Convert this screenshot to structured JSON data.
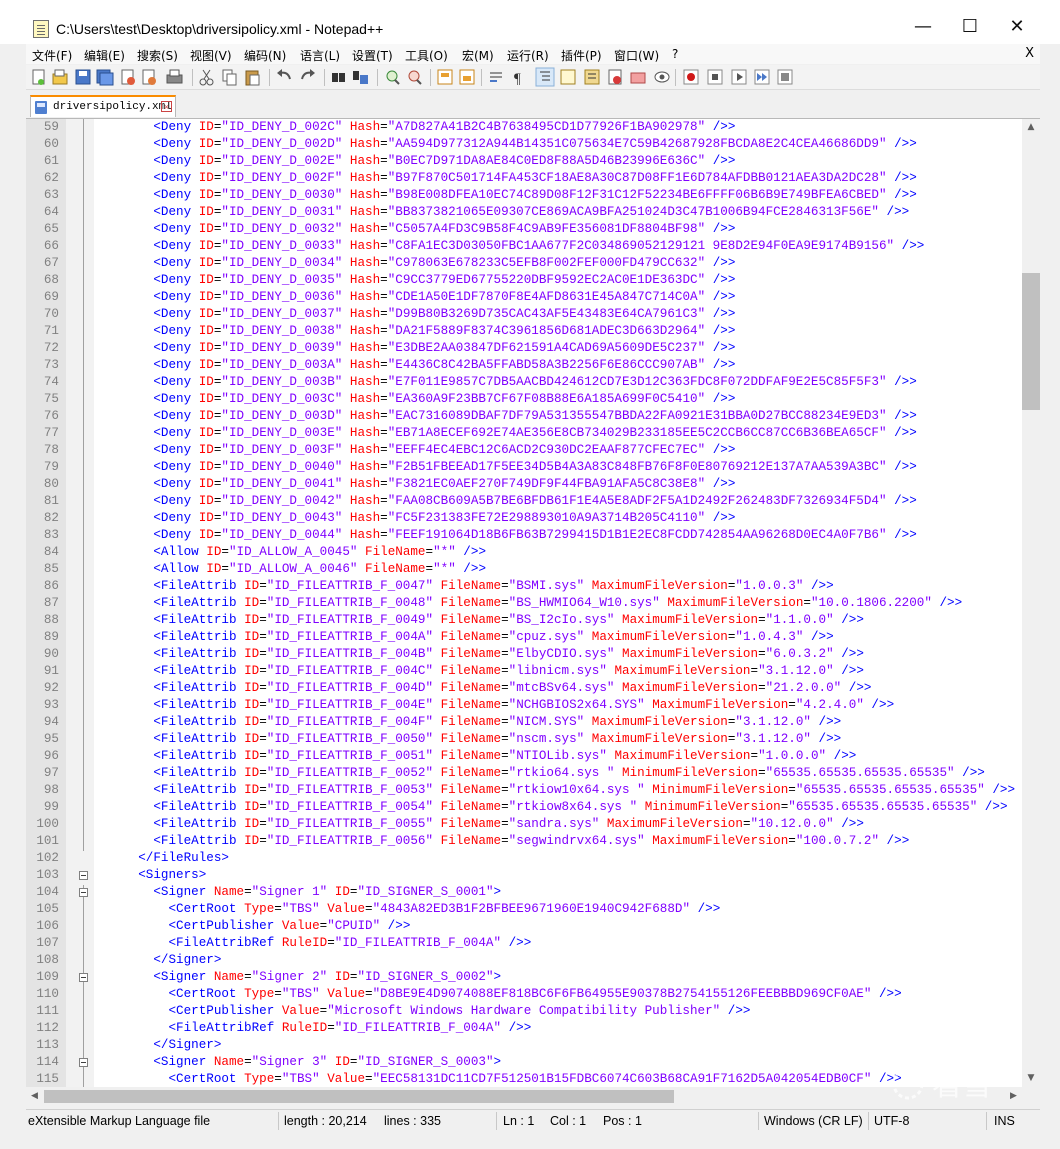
{
  "window": {
    "title": "C:\\Users\\test\\Desktop\\driversipolicy.xml - Notepad++",
    "minimize": "—",
    "maximize": "☐",
    "close": "✕"
  },
  "menu": {
    "items": [
      "文件(F)",
      "编辑(E)",
      "搜索(S)",
      "视图(V)",
      "编码(N)",
      "语言(L)",
      "设置(T)",
      "工具(O)",
      "宏(M)",
      "运行(R)",
      "插件(P)",
      "窗口(W)",
      "?"
    ],
    "close": "X"
  },
  "toolbar": {
    "buttons": [
      "new-file-icon",
      "open-file-icon",
      "save-icon",
      "save-all-icon",
      "close-icon",
      "close-all-icon",
      "print-icon",
      "cut-icon",
      "copy-icon",
      "paste-icon",
      "undo-icon",
      "redo-icon",
      "find-icon",
      "replace-icon",
      "zoom-in-icon",
      "zoom-out-icon",
      "sync-vertical-icon",
      "sync-horizontal-icon",
      "word-wrap-icon",
      "show-all-chars-icon",
      "indent-guide-icon",
      "doc-map-icon",
      "function-list-icon",
      "folder-workspace-icon",
      "doc-switcher-icon",
      "monitoring-icon",
      "record-macro-icon",
      "stop-record-icon",
      "play-macro-icon",
      "run-macro-multiple-icon",
      "save-macro-icon"
    ]
  },
  "tab": {
    "label": "driversipolicy.xml"
  },
  "editor": {
    "lines": [
      {
        "n": "59",
        "indent": "      ",
        "tag": "Deny",
        "attrs": [
          [
            "ID",
            "ID_DENY_D_002C"
          ],
          [
            "Hash",
            "A7D827A41B2C4B7638495CD1D77926F1BA902978"
          ]
        ],
        "end": " />"
      },
      {
        "n": "60",
        "indent": "      ",
        "tag": "Deny",
        "attrs": [
          [
            "ID",
            "ID_DENY_D_002D"
          ],
          [
            "Hash",
            "AA594D977312A944B14351C075634E7C59B42687928FBCDA8E2C4CEA46686DD9"
          ]
        ],
        "end": " />"
      },
      {
        "n": "61",
        "indent": "      ",
        "tag": "Deny",
        "attrs": [
          [
            "ID",
            "ID_DENY_D_002E"
          ],
          [
            "Hash",
            "B0EC7D971DA8AE84C0ED8F88A5D46B23996E636C"
          ]
        ],
        "end": " />"
      },
      {
        "n": "62",
        "indent": "      ",
        "tag": "Deny",
        "attrs": [
          [
            "ID",
            "ID_DENY_D_002F"
          ],
          [
            "Hash",
            "B97F870C501714FA453CF18AE8A30C87D08FF1E6D784AFDBB0121AEA3DA2DC28"
          ]
        ],
        "end": " />"
      },
      {
        "n": "63",
        "indent": "      ",
        "tag": "Deny",
        "attrs": [
          [
            "ID",
            "ID_DENY_D_0030"
          ],
          [
            "Hash",
            "B98E008DFEA10EC74C89D08F12F31C12F52234BE6FFFF06B6B9E749BFEA6CBED"
          ]
        ],
        "end": " />"
      },
      {
        "n": "64",
        "indent": "      ",
        "tag": "Deny",
        "attrs": [
          [
            "ID",
            "ID_DENY_D_0031"
          ],
          [
            "Hash",
            "BB8373821065E09307CE869ACA9BFA251024D3C47B1006B94FCE2846313F56E"
          ]
        ],
        "end": " />"
      },
      {
        "n": "65",
        "indent": "      ",
        "tag": "Deny",
        "attrs": [
          [
            "ID",
            "ID_DENY_D_0032"
          ],
          [
            "Hash",
            "C5057A4FD3C9B58F4C9AB9FE356081DF8804BF98"
          ]
        ],
        "end": " />"
      },
      {
        "n": "66",
        "indent": "      ",
        "tag": "Deny",
        "attrs": [
          [
            "ID",
            "ID_DENY_D_0033"
          ],
          [
            "Hash",
            "C8FA1EC3D03050FBC1AA677F2C034869052129121 9E8D2E94F0EA9E9174B9156"
          ]
        ],
        "end": " />"
      },
      {
        "n": "67",
        "indent": "      ",
        "tag": "Deny",
        "attrs": [
          [
            "ID",
            "ID_DENY_D_0034"
          ],
          [
            "Hash",
            "C978063E678233C5EFB8F002FEF000FD479CC632"
          ]
        ],
        "end": " />"
      },
      {
        "n": "68",
        "indent": "      ",
        "tag": "Deny",
        "attrs": [
          [
            "ID",
            "ID_DENY_D_0035"
          ],
          [
            "Hash",
            "C9CC3779ED67755220DBF9592EC2AC0E1DE363DC"
          ]
        ],
        "end": " />"
      },
      {
        "n": "69",
        "indent": "      ",
        "tag": "Deny",
        "attrs": [
          [
            "ID",
            "ID_DENY_D_0036"
          ],
          [
            "Hash",
            "CDE1A50E1DF7870F8E4AFD8631E45A847C714C0A"
          ]
        ],
        "end": " />"
      },
      {
        "n": "70",
        "indent": "      ",
        "tag": "Deny",
        "attrs": [
          [
            "ID",
            "ID_DENY_D_0037"
          ],
          [
            "Hash",
            "D99B80B3269D735CAC43AF5E43483E64CA7961C3"
          ]
        ],
        "end": " />"
      },
      {
        "n": "71",
        "indent": "      ",
        "tag": "Deny",
        "attrs": [
          [
            "ID",
            "ID_DENY_D_0038"
          ],
          [
            "Hash",
            "DA21F5889F8374C3961856D681ADEC3D663D2964"
          ]
        ],
        "end": " />"
      },
      {
        "n": "72",
        "indent": "      ",
        "tag": "Deny",
        "attrs": [
          [
            "ID",
            "ID_DENY_D_0039"
          ],
          [
            "Hash",
            "E3DBE2AA03847DF621591A4CAD69A5609DE5C237"
          ]
        ],
        "end": " />"
      },
      {
        "n": "73",
        "indent": "      ",
        "tag": "Deny",
        "attrs": [
          [
            "ID",
            "ID_DENY_D_003A"
          ],
          [
            "Hash",
            "E4436C8C42BA5FFABD58A3B2256F6E86CCC907AB"
          ]
        ],
        "end": " />"
      },
      {
        "n": "74",
        "indent": "      ",
        "tag": "Deny",
        "attrs": [
          [
            "ID",
            "ID_DENY_D_003B"
          ],
          [
            "Hash",
            "E7F011E9857C7DB5AACBD424612CD7E3D12C363FDC8F072DDFAF9E2E5C85F5F3"
          ]
        ],
        "end": " />"
      },
      {
        "n": "75",
        "indent": "      ",
        "tag": "Deny",
        "attrs": [
          [
            "ID",
            "ID_DENY_D_003C"
          ],
          [
            "Hash",
            "EA360A9F23BB7CF67F08B88E6A185A699F0C5410"
          ]
        ],
        "end": " />"
      },
      {
        "n": "76",
        "indent": "      ",
        "tag": "Deny",
        "attrs": [
          [
            "ID",
            "ID_DENY_D_003D"
          ],
          [
            "Hash",
            "EAC7316089DBAF7DF79A531355547BBDA22FA0921E31BBA0D27BCC88234E9ED3"
          ]
        ],
        "end": " />"
      },
      {
        "n": "77",
        "indent": "      ",
        "tag": "Deny",
        "attrs": [
          [
            "ID",
            "ID_DENY_D_003E"
          ],
          [
            "Hash",
            "EB71A8ECEF692E74AE356E8CB734029B233185EE5C2CCB6CC87CC6B36BEA65CF"
          ]
        ],
        "end": " />"
      },
      {
        "n": "78",
        "indent": "      ",
        "tag": "Deny",
        "attrs": [
          [
            "ID",
            "ID_DENY_D_003F"
          ],
          [
            "Hash",
            "EEFF4EC4EBC12C6ACD2C930DC2EAAF877CFEC7EC"
          ]
        ],
        "end": " />"
      },
      {
        "n": "79",
        "indent": "      ",
        "tag": "Deny",
        "attrs": [
          [
            "ID",
            "ID_DENY_D_0040"
          ],
          [
            "Hash",
            "F2B51FBEEAD17F5EE34D5B4A3A83C848FB76F8F0E80769212E137A7AA539A3BC"
          ]
        ],
        "end": " />"
      },
      {
        "n": "80",
        "indent": "      ",
        "tag": "Deny",
        "attrs": [
          [
            "ID",
            "ID_DENY_D_0041"
          ],
          [
            "Hash",
            "F3821EC0AEF270F749DF9F44FBA91AFA5C8C38E8"
          ]
        ],
        "end": " />"
      },
      {
        "n": "81",
        "indent": "      ",
        "tag": "Deny",
        "attrs": [
          [
            "ID",
            "ID_DENY_D_0042"
          ],
          [
            "Hash",
            "FAA08CB609A5B7BE6BFDB61F1E4A5E8ADF2F5A1D2492F262483DF7326934F5D4"
          ]
        ],
        "end": " />"
      },
      {
        "n": "82",
        "indent": "      ",
        "tag": "Deny",
        "attrs": [
          [
            "ID",
            "ID_DENY_D_0043"
          ],
          [
            "Hash",
            "FC5F231383FE72E298893010A9A3714B205C4110"
          ]
        ],
        "end": " />"
      },
      {
        "n": "83",
        "indent": "      ",
        "tag": "Deny",
        "attrs": [
          [
            "ID",
            "ID_DENY_D_0044"
          ],
          [
            "Hash",
            "FEEF191064D18B6FB63B7299415D1B1E2EC8FCDD742854AA96268D0EC4A0F7B6"
          ]
        ],
        "end": " />"
      },
      {
        "n": "84",
        "indent": "      ",
        "tag": "Allow",
        "attrs": [
          [
            "ID",
            "ID_ALLOW_A_0045"
          ],
          [
            "FileName",
            "*"
          ]
        ],
        "end": " />"
      },
      {
        "n": "85",
        "indent": "      ",
        "tag": "Allow",
        "attrs": [
          [
            "ID",
            "ID_ALLOW_A_0046"
          ],
          [
            "FileName",
            "*"
          ]
        ],
        "end": " />"
      },
      {
        "n": "86",
        "indent": "      ",
        "tag": "FileAttrib",
        "attrs": [
          [
            "ID",
            "ID_FILEATTRIB_F_0047"
          ],
          [
            "FileName",
            "BSMI.sys"
          ],
          [
            "MaximumFileVersion",
            "1.0.0.3"
          ]
        ],
        "end": " />"
      },
      {
        "n": "87",
        "indent": "      ",
        "tag": "FileAttrib",
        "attrs": [
          [
            "ID",
            "ID_FILEATTRIB_F_0048"
          ],
          [
            "FileName",
            "BS_HWMIO64_W10.sys"
          ],
          [
            "MaximumFileVersion",
            "10.0.1806.2200"
          ]
        ],
        "end": " />"
      },
      {
        "n": "88",
        "indent": "      ",
        "tag": "FileAttrib",
        "attrs": [
          [
            "ID",
            "ID_FILEATTRIB_F_0049"
          ],
          [
            "FileName",
            "BS_I2cIo.sys"
          ],
          [
            "MaximumFileVersion",
            "1.1.0.0"
          ]
        ],
        "end": " />"
      },
      {
        "n": "89",
        "indent": "      ",
        "tag": "FileAttrib",
        "attrs": [
          [
            "ID",
            "ID_FILEATTRIB_F_004A"
          ],
          [
            "FileName",
            "cpuz.sys"
          ],
          [
            "MaximumFileVersion",
            "1.0.4.3"
          ]
        ],
        "end": " />"
      },
      {
        "n": "90",
        "indent": "      ",
        "tag": "FileAttrib",
        "attrs": [
          [
            "ID",
            "ID_FILEATTRIB_F_004B"
          ],
          [
            "FileName",
            "ElbyCDIO.sys"
          ],
          [
            "MaximumFileVersion",
            "6.0.3.2"
          ]
        ],
        "end": " />"
      },
      {
        "n": "91",
        "indent": "      ",
        "tag": "FileAttrib",
        "attrs": [
          [
            "ID",
            "ID_FILEATTRIB_F_004C"
          ],
          [
            "FileName",
            "libnicm.sys"
          ],
          [
            "MaximumFileVersion",
            "3.1.12.0"
          ]
        ],
        "end": " />"
      },
      {
        "n": "92",
        "indent": "      ",
        "tag": "FileAttrib",
        "attrs": [
          [
            "ID",
            "ID_FILEATTRIB_F_004D"
          ],
          [
            "FileName",
            "mtcBSv64.sys"
          ],
          [
            "MaximumFileVersion",
            "21.2.0.0"
          ]
        ],
        "end": " />"
      },
      {
        "n": "93",
        "indent": "      ",
        "tag": "FileAttrib",
        "attrs": [
          [
            "ID",
            "ID_FILEATTRIB_F_004E"
          ],
          [
            "FileName",
            "NCHGBIOS2x64.SYS"
          ],
          [
            "MaximumFileVersion",
            "4.2.4.0"
          ]
        ],
        "end": " />"
      },
      {
        "n": "94",
        "indent": "      ",
        "tag": "FileAttrib",
        "attrs": [
          [
            "ID",
            "ID_FILEATTRIB_F_004F"
          ],
          [
            "FileName",
            "NICM.SYS"
          ],
          [
            "MaximumFileVersion",
            "3.1.12.0"
          ]
        ],
        "end": " />"
      },
      {
        "n": "95",
        "indent": "      ",
        "tag": "FileAttrib",
        "attrs": [
          [
            "ID",
            "ID_FILEATTRIB_F_0050"
          ],
          [
            "FileName",
            "nscm.sys"
          ],
          [
            "MaximumFileVersion",
            "3.1.12.0"
          ]
        ],
        "end": " />"
      },
      {
        "n": "96",
        "indent": "      ",
        "tag": "FileAttrib",
        "attrs": [
          [
            "ID",
            "ID_FILEATTRIB_F_0051"
          ],
          [
            "FileName",
            "NTIOLib.sys"
          ],
          [
            "MaximumFileVersion",
            "1.0.0.0"
          ]
        ],
        "end": " />"
      },
      {
        "n": "97",
        "indent": "      ",
        "tag": "FileAttrib",
        "attrs": [
          [
            "ID",
            "ID_FILEATTRIB_F_0052"
          ],
          [
            "FileName",
            "rtkio64.sys "
          ],
          [
            "MinimumFileVersion",
            "65535.65535.65535.65535"
          ]
        ],
        "end": " />"
      },
      {
        "n": "98",
        "indent": "      ",
        "tag": "FileAttrib",
        "attrs": [
          [
            "ID",
            "ID_FILEATTRIB_F_0053"
          ],
          [
            "FileName",
            "rtkiow10x64.sys "
          ],
          [
            "MinimumFileVersion",
            "65535.65535.65535.65535"
          ]
        ],
        "end": " />"
      },
      {
        "n": "99",
        "indent": "      ",
        "tag": "FileAttrib",
        "attrs": [
          [
            "ID",
            "ID_FILEATTRIB_F_0054"
          ],
          [
            "FileName",
            "rtkiow8x64.sys "
          ],
          [
            "MinimumFileVersion",
            "65535.65535.65535.65535"
          ]
        ],
        "end": " />"
      },
      {
        "n": "100",
        "indent": "      ",
        "tag": "FileAttrib",
        "attrs": [
          [
            "ID",
            "ID_FILEATTRIB_F_0055"
          ],
          [
            "FileName",
            "sandra.sys"
          ],
          [
            "MaximumFileVersion",
            "10.12.0.0"
          ]
        ],
        "end": " />"
      },
      {
        "n": "101",
        "indent": "      ",
        "tag": "FileAttrib",
        "attrs": [
          [
            "ID",
            "ID_FILEATTRIB_F_0056"
          ],
          [
            "FileName",
            "segwindrvx64.sys"
          ],
          [
            "MaximumFileVersion",
            "100.0.7.2"
          ]
        ],
        "end": " />"
      },
      {
        "n": "102",
        "indent": "    ",
        "tag": "/FileRules",
        "attrs": [],
        "end": ""
      },
      {
        "n": "103",
        "indent": "    ",
        "tag": "Signers",
        "attrs": [],
        "end": "",
        "fold": true
      },
      {
        "n": "104",
        "indent": "      ",
        "tag": "Signer",
        "attrs": [
          [
            "Name",
            "Signer 1"
          ],
          [
            "ID",
            "ID_SIGNER_S_0001"
          ]
        ],
        "end": "",
        "fold": true
      },
      {
        "n": "105",
        "indent": "        ",
        "tag": "CertRoot",
        "attrs": [
          [
            "Type",
            "TBS"
          ],
          [
            "Value",
            "4843A82ED3B1F2BFBEE9671960E1940C942F688D"
          ]
        ],
        "end": " />"
      },
      {
        "n": "106",
        "indent": "        ",
        "tag": "CertPublisher",
        "attrs": [
          [
            "Value",
            "CPUID"
          ]
        ],
        "end": " />"
      },
      {
        "n": "107",
        "indent": "        ",
        "tag": "FileAttribRef",
        "attrs": [
          [
            "RuleID",
            "ID_FILEATTRIB_F_004A"
          ]
        ],
        "end": " />"
      },
      {
        "n": "108",
        "indent": "      ",
        "tag": "/Signer",
        "attrs": [],
        "end": ""
      },
      {
        "n": "109",
        "indent": "      ",
        "tag": "Signer",
        "attrs": [
          [
            "Name",
            "Signer 2"
          ],
          [
            "ID",
            "ID_SIGNER_S_0002"
          ]
        ],
        "end": "",
        "fold": true
      },
      {
        "n": "110",
        "indent": "        ",
        "tag": "CertRoot",
        "attrs": [
          [
            "Type",
            "TBS"
          ],
          [
            "Value",
            "D8BE9E4D9074088EF818BC6F6FB64955E90378B2754155126FEEBBBD969CF0AE"
          ]
        ],
        "end": " />"
      },
      {
        "n": "111",
        "indent": "        ",
        "tag": "CertPublisher",
        "attrs": [
          [
            "Value",
            "Microsoft Windows Hardware Compatibility Publisher"
          ]
        ],
        "end": " />"
      },
      {
        "n": "112",
        "indent": "        ",
        "tag": "FileAttribRef",
        "attrs": [
          [
            "RuleID",
            "ID_FILEATTRIB_F_004A"
          ]
        ],
        "end": " />"
      },
      {
        "n": "113",
        "indent": "      ",
        "tag": "/Signer",
        "attrs": [],
        "end": ""
      },
      {
        "n": "114",
        "indent": "      ",
        "tag": "Signer",
        "attrs": [
          [
            "Name",
            "Signer 3"
          ],
          [
            "ID",
            "ID_SIGNER_S_0003"
          ]
        ],
        "end": "",
        "fold": true
      },
      {
        "n": "115",
        "indent": "        ",
        "tag": "CertRoot",
        "attrs": [
          [
            "Type",
            "TBS"
          ],
          [
            "Value",
            "EEC58131DC11CD7F512501B15FDBC6074C603B68CA91F7162D5A042054EDB0CF"
          ]
        ],
        "end": " />"
      }
    ]
  },
  "status": {
    "file_type": "eXtensible Markup Language file",
    "length": "length : 20,214",
    "lines": "lines : 335",
    "ln": "Ln : 1",
    "col": "Col : 1",
    "pos": "Pos : 1",
    "eol": "Windows (CR LF)",
    "encoding": "UTF-8",
    "mode": "INS"
  },
  "watermark": {
    "text": "看雪"
  }
}
